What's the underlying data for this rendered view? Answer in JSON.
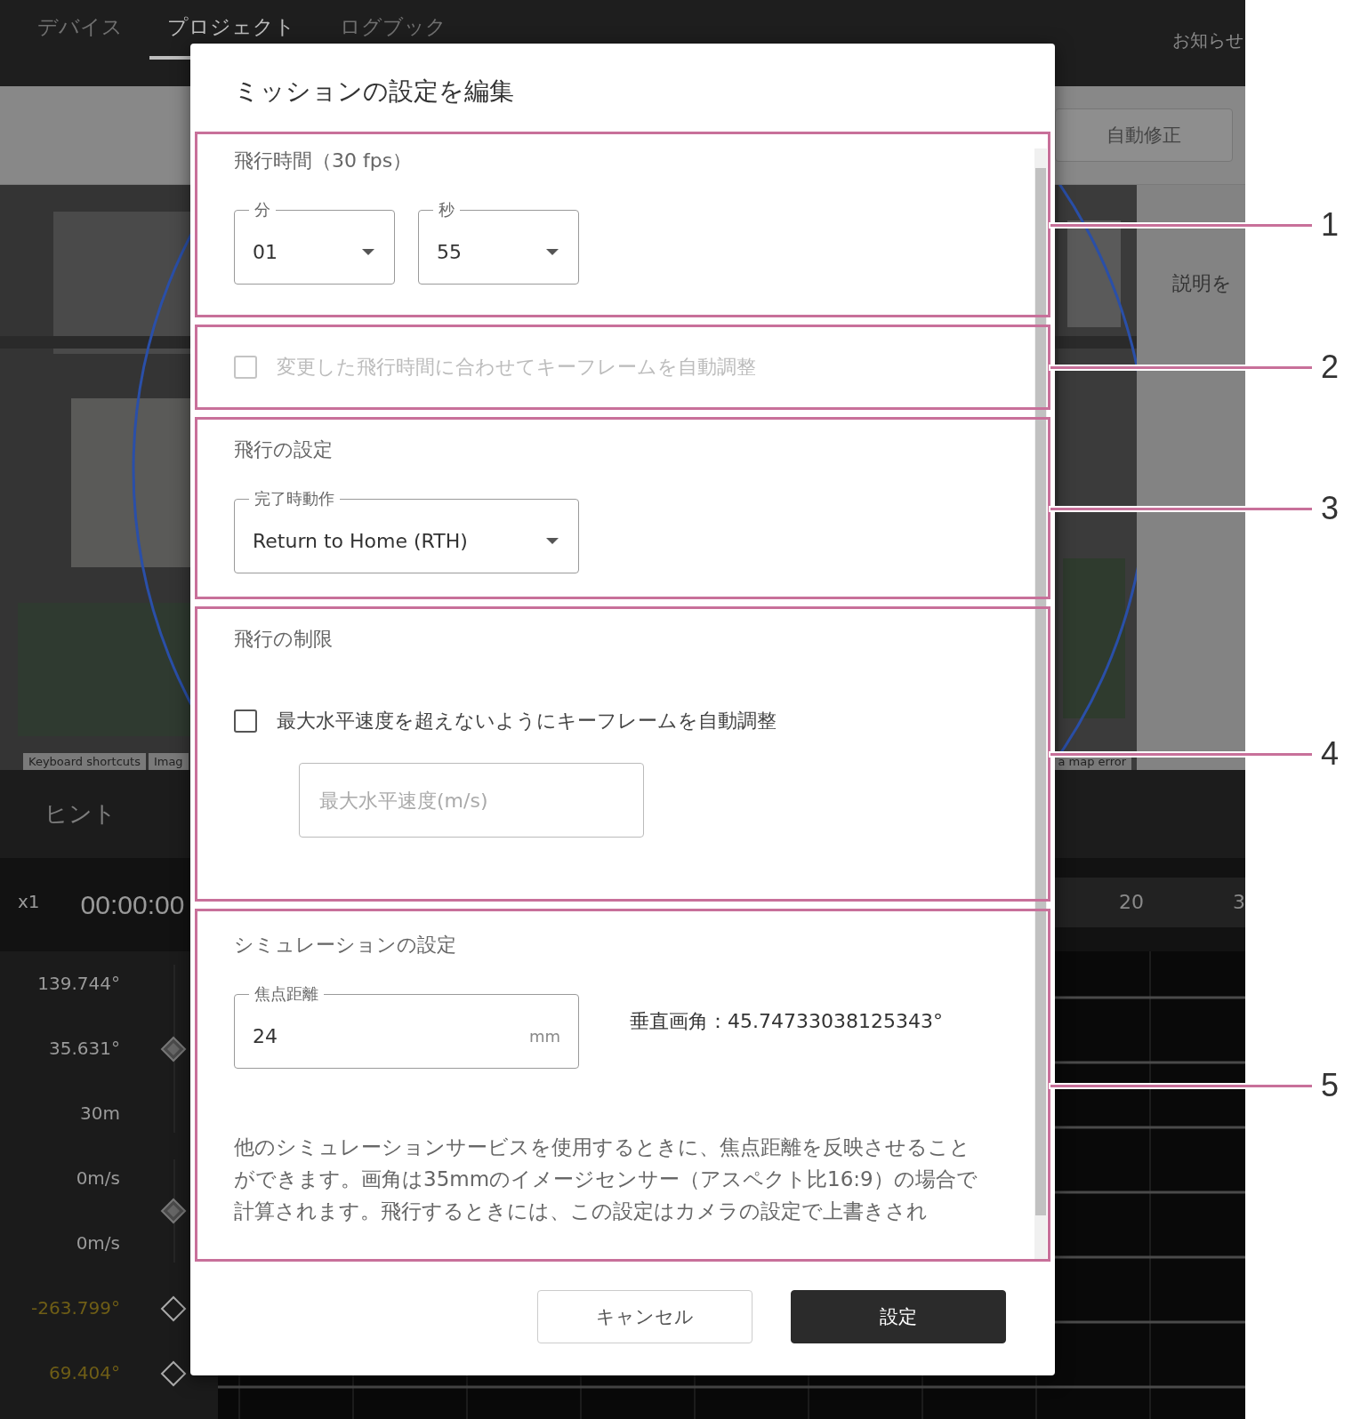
{
  "nav": {
    "tabs": [
      {
        "label": "デバイス",
        "selected": false
      },
      {
        "label": "プロジェクト",
        "selected": true
      },
      {
        "label": "ログブック",
        "selected": false
      }
    ],
    "notice": "お知らせ"
  },
  "toolbar": {
    "auto_fix_button": "自動修正"
  },
  "map": {
    "attribution": [
      "Keyboard shortcuts",
      "Imag"
    ],
    "error_link": "a map error"
  },
  "side_panel": {
    "description": "説明を"
  },
  "hint_tab": "ヒント",
  "timeline": {
    "speed": "x1",
    "time": "00:00:00",
    "ruler": [
      "20",
      "3"
    ],
    "groups": [
      {
        "values": [
          "139.744°",
          "35.631°",
          "30m"
        ],
        "kind": "filled",
        "color": "#9a9a9a"
      },
      {
        "values": [
          "0m/s",
          "0m/s"
        ],
        "kind": "filled",
        "color": "#9a9a9a"
      },
      {
        "values": [
          "-263.799°"
        ],
        "kind": "outline",
        "color": "#6f5e16"
      },
      {
        "values": [
          "69.404°"
        ],
        "kind": "outline",
        "color": "#6f5e16"
      }
    ]
  },
  "dialog": {
    "title": "ミッションの設定を編集",
    "sections": [
      {
        "kind": "duration",
        "callout": "1",
        "heading": "飛行時間（30 fps）",
        "selects": [
          {
            "label": "分",
            "value": "01"
          },
          {
            "label": "秒",
            "value": "55"
          }
        ]
      },
      {
        "kind": "auto",
        "callout": "2",
        "checkbox": {
          "label": "変更した飛行時間に合わせてキーフレームを自動調整",
          "checked": false,
          "disabled": true
        }
      },
      {
        "kind": "flight",
        "callout": "3",
        "heading": "飛行の設定",
        "selects": [
          {
            "label": "完了時動作",
            "value": "Return to Home (RTH)"
          }
        ]
      },
      {
        "kind": "limits",
        "callout": "4",
        "heading": "飛行の制限",
        "checkbox": {
          "label": "最大水平速度を超えないようにキーフレームを自動調整",
          "checked": false,
          "disabled": false
        },
        "input": {
          "placeholder": "最大水平速度(m/s)"
        }
      },
      {
        "kind": "simulation",
        "callout": "5",
        "heading": "シミュレーションの設定",
        "field": {
          "label": "焦点距離",
          "value": "24",
          "unit": "mm"
        },
        "angle": "垂直画角：45.74733038125343°",
        "note": "他のシミュレーションサービスを使用するときに、焦点距離を反映させることができます。画角は35mmのイメージセンサー（アスペクト比16:9）の場合で計算されます。飛行するときには、この設定はカメラの設定で上書きされ"
      }
    ],
    "buttons": [
      {
        "label": "キャンセル",
        "kind": "secondary"
      },
      {
        "label": "設定",
        "kind": "primary"
      }
    ]
  }
}
